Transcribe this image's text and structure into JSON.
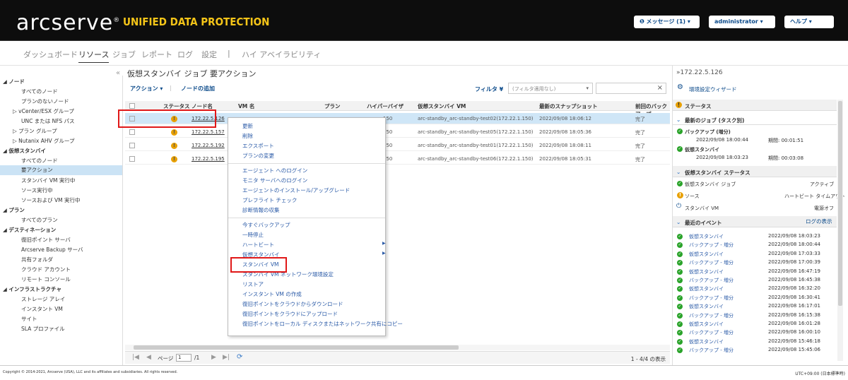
{
  "header": {
    "logo": "arcserve",
    "logo_registered": "®",
    "product": "UNIFIED DATA PROTECTION",
    "messages": "❶ メッセージ (1)  ▾",
    "user": "administrator  ▾",
    "help": "ヘルプ  ▾"
  },
  "nav": {
    "dashboard": "ダッシュボード",
    "resources": "リソース",
    "jobs": "ジョブ",
    "reports": "レポート",
    "logs": "ログ",
    "settings": "設定",
    "sep": "|",
    "ha": "ハイ アベイラビリティ"
  },
  "left": {
    "collapse": "«",
    "items": [
      "ノード",
      "すべてのノード",
      "プランのないノード",
      "vCenter/ESX グループ",
      "UNC または NFS パス",
      "プラン グループ",
      "Nutanix AHV グループ",
      "仮想スタンバイ",
      "すべてのノード",
      "要アクション",
      "スタンバイ VM 実行中",
      "ソース実行中",
      "ソースおよび VM 実行中",
      "プラン",
      "すべてのプラン",
      "デスティネーション",
      "復旧ポイント サーバ",
      "Arcserve Backup サーバ",
      "共有フォルダ",
      "クラウド アカウント",
      "リモート コンソール",
      "インフラストラクチャ",
      "ストレージ アレイ",
      "インスタント VM",
      "サイト",
      "SLA プロファイル"
    ]
  },
  "main": {
    "title": "仮想スタンバイ ジョブ 要アクション",
    "action": "アクション ▾",
    "add_node": "ノードの追加",
    "filter": "フィルタ ¥",
    "filter_value": "(フィルタ適用なし)",
    "filter_dd": "▾",
    "clear": "×"
  },
  "table": {
    "columns": [
      "ステータス",
      "ノード名",
      "VM 名",
      "プラン",
      "ハイパーバイザ",
      "仮想スタンバイ VM",
      "最新のスナップショット",
      "前回のバックアップ"
    ],
    "rows": [
      {
        "node": "172.22.5.126",
        "vm": "",
        "plan": "",
        "hyp": "150",
        "svm": "arc-standby_arc-standby-test02(172.22.1.150)",
        "snap": "2022/09/08 18:06:12",
        "last": "完了"
      },
      {
        "node": "172.22.5.157",
        "vm": "",
        "plan": "",
        "hyp": "150",
        "svm": "arc-standby_arc-standby-test05(172.22.1.150)",
        "snap": "2022/09/08 18:05:36",
        "last": "完了"
      },
      {
        "node": "172.22.5.192",
        "vm": "",
        "plan": "",
        "hyp": "150",
        "svm": "arc-standby_arc-standby-test01(172.22.1.150)",
        "snap": "2022/09/08 18:08:11",
        "last": "完了"
      },
      {
        "node": "172.22.5.195",
        "vm": "",
        "plan": "",
        "hyp": "150",
        "svm": "arc-standby_arc-standby-test06(172.22.1.150)",
        "snap": "2022/09/08 18:05:31",
        "last": "完了"
      }
    ]
  },
  "menu": [
    "更新",
    "削除",
    "エクスポート",
    "プランの変更",
    "エージェント へのログイン",
    "モニタ サーバへのログイン",
    "エージェントのインストール/アップグレード",
    "プレフライト チェック",
    "診断情報の収集",
    "今すぐバックアップ",
    "一時停止",
    "ハートビート",
    "仮想スタンバイ",
    "スタンバイ VM",
    "スタンバイ VM ネットワーク環境設定",
    "リストア",
    "インスタント VM の作成",
    "復旧ポイントをクラウドからダウンロード",
    "復旧ポイントをクラウドにアップロード",
    "復旧ポイントをローカル ディスクまたはネットワーク共有にコピー"
  ],
  "menu_arrow": "▶",
  "pager": {
    "page_label": "ページ",
    "page": "1",
    "of": "/1",
    "count": "1 - 4/4 の表示"
  },
  "right": {
    "breadcrumb": "»172.22.5.126",
    "wizard": "環境設定ウィザード",
    "status": "ステータス",
    "latest_job": "最新のジョブ (タスク別)",
    "job1": "バックアップ (増分)",
    "job1_time": "2022/09/08 18:00:44",
    "job1_dur": "期間: 00:01:51",
    "job2": "仮想スタンバイ",
    "job2_time": "2022/09/08 18:03:23",
    "job2_dur": "期間: 00:03:08",
    "vs_status": "仮想スタンバイ ステータス",
    "vs_job": "仮想スタンバイ ジョブ",
    "vs_job_val": "アクティブ",
    "source": "ソース",
    "source_val": "ハートビート タイムアウト",
    "standby": "スタンバイ VM",
    "standby_val": "電源オフ",
    "events": "最近のイベント",
    "log": "ログの表示",
    "event_list": [
      [
        "仮想スタンバイ",
        "2022/09/08 18:03:23"
      ],
      [
        "バックアップ - 増分",
        "2022/09/08 18:00:44"
      ],
      [
        "仮想スタンバイ",
        "2022/09/08 17:03:33"
      ],
      [
        "バックアップ - 増分",
        "2022/09/08 17:00:39"
      ],
      [
        "仮想スタンバイ",
        "2022/09/08 16:47:19"
      ],
      [
        "バックアップ - 増分",
        "2022/09/08 16:45:38"
      ],
      [
        "仮想スタンバイ",
        "2022/09/08 16:32:20"
      ],
      [
        "バックアップ - 増分",
        "2022/09/08 16:30:41"
      ],
      [
        "仮想スタンバイ",
        "2022/09/08 16:17:01"
      ],
      [
        "バックアップ - 増分",
        "2022/09/08 16:15:38"
      ],
      [
        "仮想スタンバイ",
        "2022/09/08 16:01:28"
      ],
      [
        "バックアップ - 増分",
        "2022/09/08 16:00:10"
      ],
      [
        "仮想スタンバイ",
        "2022/09/08 15:46:18"
      ],
      [
        "バックアップ - 増分",
        "2022/09/08 15:45:06"
      ]
    ]
  },
  "footer": {
    "copyright": "Copyright © 2014-2021, Arcserve (USA), LLC and its affiliates and subsidiaries. All rights reserved.",
    "tz": "UTC+09:00 (日本標準時)"
  }
}
